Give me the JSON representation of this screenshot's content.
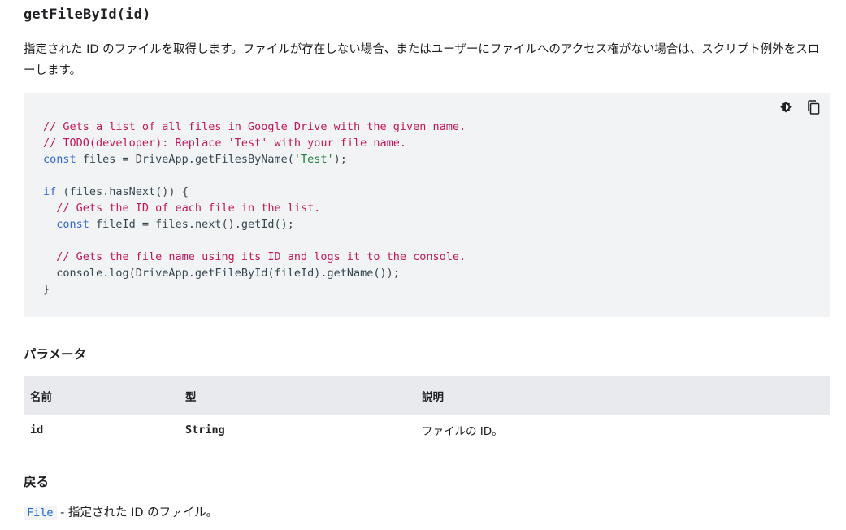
{
  "method": {
    "signature": "getFileById(id)",
    "description": "指定された ID のファイルを取得します。ファイルが存在しない場合、またはユーザーにファイルへのアクセス権がない場合は、スクリプト例外をスローします。"
  },
  "code": {
    "l1": "// Gets a list of all files in Google Drive with the given name.",
    "l2": "// TODO(developer): Replace 'Test' with your file name.",
    "l3_kw": "const",
    "l3_a": " files = DriveApp.getFilesByName(",
    "l3_str": "'Test'",
    "l3_b": ");",
    "l5_kw": "if",
    "l5_a": " (files.hasNext()) {",
    "l6": "  // Gets the ID of each file in the list.",
    "l7_ind": "  ",
    "l7_kw": "const",
    "l7_a": " fileId = files.next().getId();",
    "l9": "  // Gets the file name using its ID and logs it to the console.",
    "l10": "  console.log(DriveApp.getFileById(fileId).getName());",
    "l11": "}",
    "toggle_theme_icon": "dark-mode-icon",
    "copy_icon": "copy-icon"
  },
  "params": {
    "heading": "パラメータ",
    "columns": [
      "名前",
      "型",
      "説明"
    ],
    "rows": [
      {
        "name": "id",
        "type": "String",
        "desc": "ファイルの ID。"
      }
    ]
  },
  "returns": {
    "heading": "戻る",
    "type": "File",
    "desc": " - 指定された ID のファイル。"
  }
}
